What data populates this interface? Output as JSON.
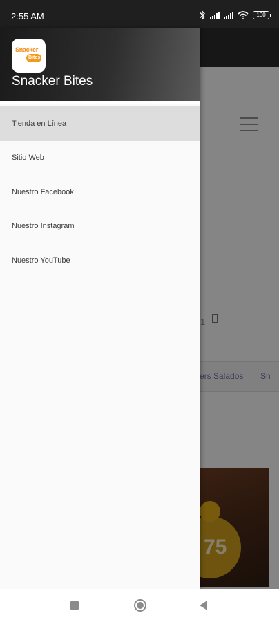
{
  "status_bar": {
    "time": "2:55 AM",
    "battery": "100",
    "icons": [
      "bluetooth-icon",
      "signal-icon",
      "signal-icon",
      "wifi-icon",
      "battery-icon"
    ]
  },
  "background_app": {
    "tabs": [
      "ers Salados",
      "Sn"
    ],
    "phone_digit": "1",
    "promo_price": "75"
  },
  "drawer": {
    "app_name": "Snacker Bites",
    "logo_text_top": "Snacker",
    "logo_text_bottom": "Bites",
    "items": [
      {
        "label": "Tienda en Línea",
        "active": true
      },
      {
        "label": "Sitio Web",
        "active": false
      },
      {
        "label": "Nuestro Facebook",
        "active": false
      },
      {
        "label": "Nuestro Instagram",
        "active": false
      },
      {
        "label": "Nuestro YouTube",
        "active": false
      }
    ]
  },
  "nav_bar": {
    "buttons": [
      "recent-apps-icon",
      "home-icon",
      "back-icon"
    ]
  },
  "colors": {
    "drawer_header": "#2e2e2e",
    "active_item_bg": "#dddddd",
    "logo_orange": "#f08a12"
  }
}
